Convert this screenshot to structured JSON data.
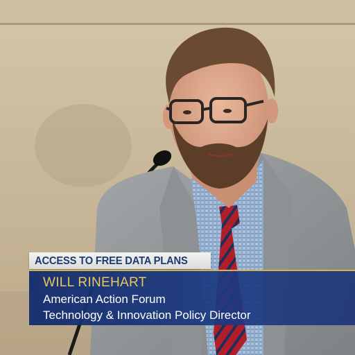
{
  "broadcast": {
    "topic_label": "ACCESS TO FREE DATA PLANS",
    "speaker_name": "WILL RINEHART",
    "speaker_org": "American Action Forum",
    "speaker_title": "Technology & Innovation Policy Director"
  },
  "colors": {
    "topic_text": "#1d3a72",
    "name_text": "#e9c85c",
    "name_box": "#1c3a82",
    "accent_rule": "#d6b24a"
  }
}
